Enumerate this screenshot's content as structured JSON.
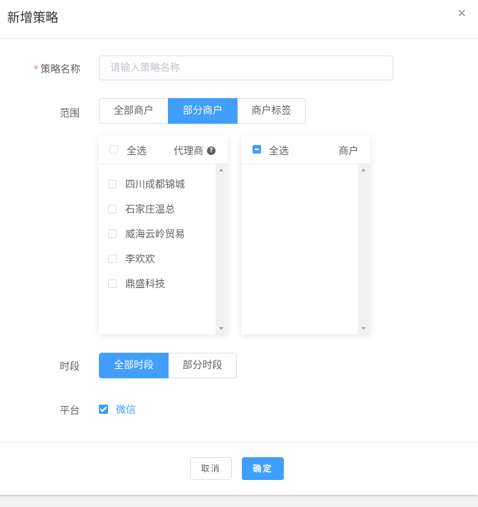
{
  "dialog": {
    "title": "新增策略",
    "close_icon": "close-icon"
  },
  "form": {
    "name": {
      "required_mark": "*",
      "label": "策略名称",
      "placeholder": "请输入策略名称",
      "value": ""
    },
    "scope": {
      "label": "范围",
      "options": [
        "全部商户",
        "部分商户",
        "商户标签"
      ],
      "selected": "部分商户"
    },
    "time": {
      "label": "时段",
      "options": [
        "全部时段",
        "部分时段"
      ],
      "selected": "全部时段"
    },
    "platform": {
      "label": "平台",
      "option": "微信",
      "checked": true
    }
  },
  "transfer": {
    "left": {
      "select_all": "全选",
      "title": "代理商",
      "help_icon": "question-circle-icon",
      "items": [
        "四川成都锦城",
        "石家庄温总",
        "威海云岭贸易",
        "李欢欢",
        "鼎盛科技"
      ]
    },
    "right": {
      "select_all": "全选",
      "title": "商户",
      "items": []
    }
  },
  "footer": {
    "cancel_label": "取消",
    "ok_label": "确定"
  },
  "colors": {
    "primary": "#409eff",
    "required": "#f56c6c",
    "text": "#606266",
    "border": "#dcdfe6"
  }
}
